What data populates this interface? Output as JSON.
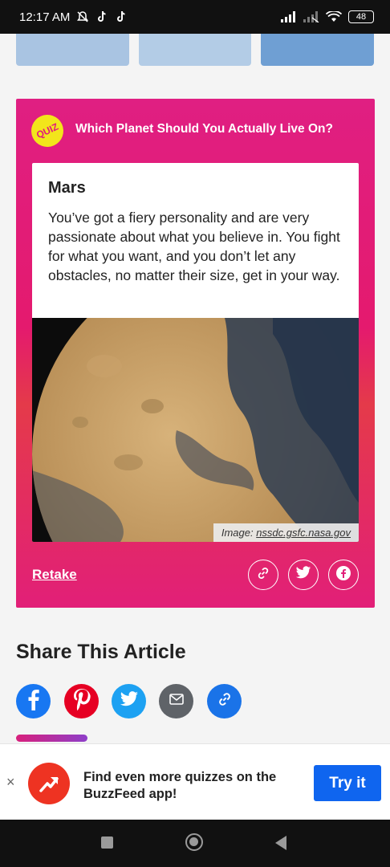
{
  "status_bar": {
    "time": "12:17 AM",
    "battery": "48",
    "icons": [
      "mute-icon",
      "tiktok-icon",
      "tiktok-icon",
      "signal-icon",
      "signal-off-icon",
      "wifi-icon",
      "battery-icon"
    ]
  },
  "quiz": {
    "badge": "QUIZ",
    "title": "Which Planet Should You Actually Live On?",
    "result_title": "Mars",
    "result_description": "You’ve got a fiery personality and are very passionate about what you believe in. You fight for what you want, and you don’t let any obstacles, no matter their size, get in your way.",
    "image_credit_prefix": "Image: ",
    "image_credit_link": "nssdc.gsfc.nasa.gov",
    "retake_label": "Retake",
    "share_icons": [
      "link-icon",
      "twitter-icon",
      "facebook-icon"
    ]
  },
  "share": {
    "heading": "Share This Article",
    "buttons": [
      "facebook-icon",
      "pinterest-icon",
      "twitter-icon",
      "email-icon",
      "link-icon"
    ]
  },
  "app_banner": {
    "close": "×",
    "text": "Find even more quizzes on the BuzzFeed app!",
    "button": "Try it"
  },
  "colors": {
    "quiz_card": "#e01f82",
    "quiz_badge": "#f2e61b",
    "try_button": "#0f65ef",
    "facebook": "#1877f2",
    "pinterest": "#e60023",
    "twitter": "#1da1f2",
    "email": "#5f6368",
    "link": "#1a73e8"
  }
}
